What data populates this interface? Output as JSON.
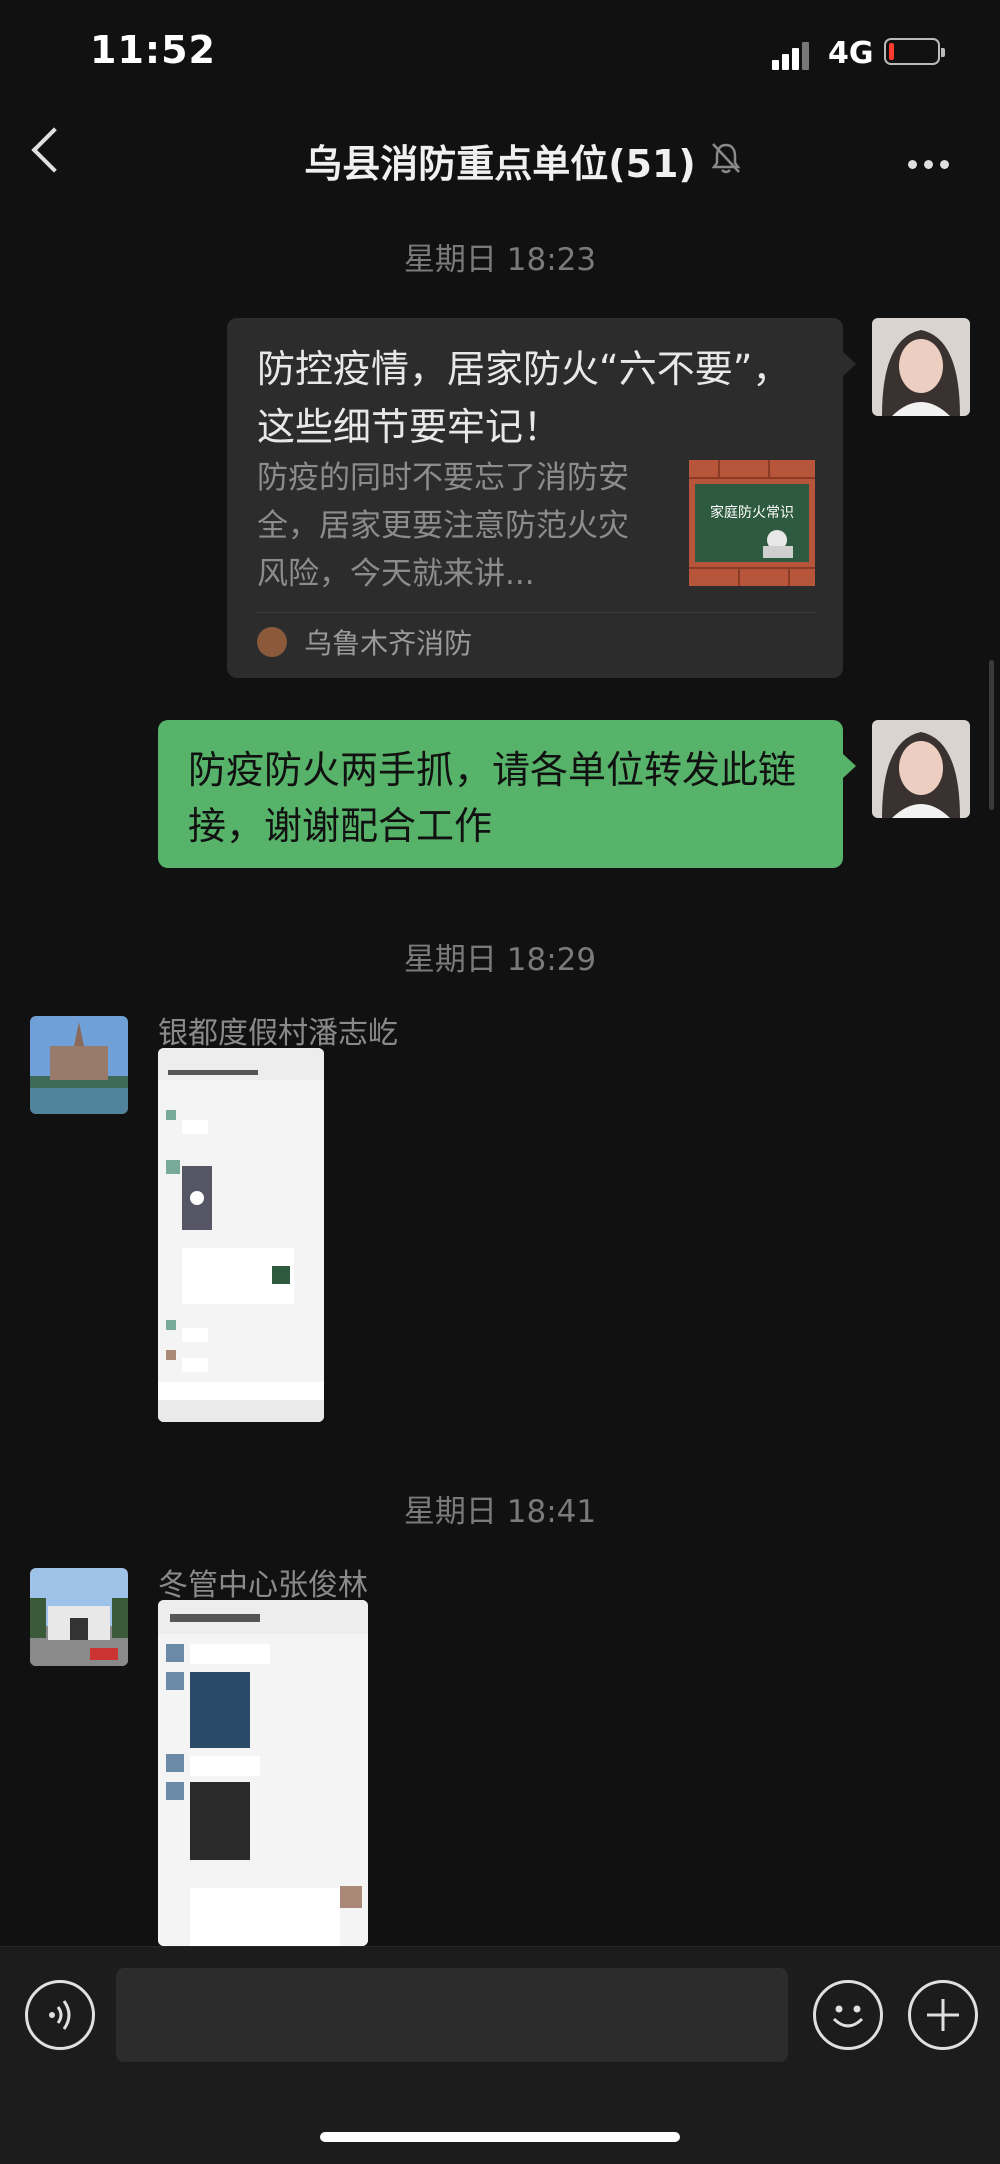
{
  "status_bar": {
    "time": "11:52",
    "network": "4G"
  },
  "nav": {
    "title": "乌县消防重点单位(51)",
    "muted_icon": "bell-slash-icon",
    "more_icon": "more-dots-icon"
  },
  "messages": {
    "sep1": "星期日 18:23",
    "link_card": {
      "title": "防控疫情，居家防火“六不要”，这些细节要牢记！",
      "desc": "防疫的同时不要忘了消防安全，居家更要注意防范火灾风险，今天就来讲...",
      "thumb_text": "家庭防火常识",
      "source": "乌鲁木齐消防"
    },
    "bubble_text": "防疫防火两手抓，请各单位转发此链接，谢谢配合工作",
    "sep2": "星期日 18:29",
    "sender1": "银都度假村潘志屹",
    "sep3": "星期日 18:41",
    "sender2": "冬管中心张俊林"
  },
  "bottom_bar": {
    "voice_icon": "voice-icon",
    "emoji_icon": "emoji-icon",
    "plus_icon": "plus-icon"
  },
  "colors": {
    "bg": "#111111",
    "green_bubble": "#57b369",
    "card_bg": "#2c2c2c"
  }
}
